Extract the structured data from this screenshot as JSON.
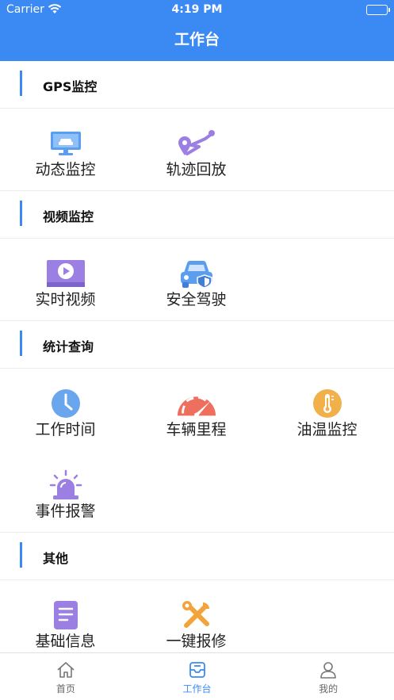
{
  "status_bar": {
    "carrier": "Carrier",
    "time": "4:19 PM"
  },
  "nav": {
    "title": "工作台"
  },
  "sections": [
    {
      "title": "GPS监控",
      "items": [
        {
          "label": "动态监控",
          "icon": "monitor-car-icon"
        },
        {
          "label": "轨迹回放",
          "icon": "route-pin-icon"
        }
      ]
    },
    {
      "title": "视频监控",
      "items": [
        {
          "label": "实时视频",
          "icon": "video-play-icon"
        },
        {
          "label": "安全驾驶",
          "icon": "car-shield-icon"
        }
      ]
    },
    {
      "title": "统计查询",
      "items": [
        {
          "label": "工作时间",
          "icon": "clock-icon"
        },
        {
          "label": "车辆里程",
          "icon": "speedometer-icon"
        },
        {
          "label": "油温监控",
          "icon": "thermometer-icon"
        },
        {
          "label": "事件报警",
          "icon": "alarm-siren-icon"
        }
      ]
    },
    {
      "title": "其他",
      "items": [
        {
          "label": "基础信息",
          "icon": "document-icon"
        },
        {
          "label": "一键报修",
          "icon": "tools-icon"
        }
      ]
    }
  ],
  "tabs": [
    {
      "label": "首页",
      "icon": "home-icon"
    },
    {
      "label": "工作台",
      "icon": "workbench-icon",
      "active": true
    },
    {
      "label": "我的",
      "icon": "user-icon"
    }
  ],
  "colors": {
    "primary": "#3b8af3",
    "clock": "#6aa6ee",
    "speedometer": "#ee6f5e",
    "thermometer": "#f2b04a",
    "purple": "#9b7fe3"
  }
}
